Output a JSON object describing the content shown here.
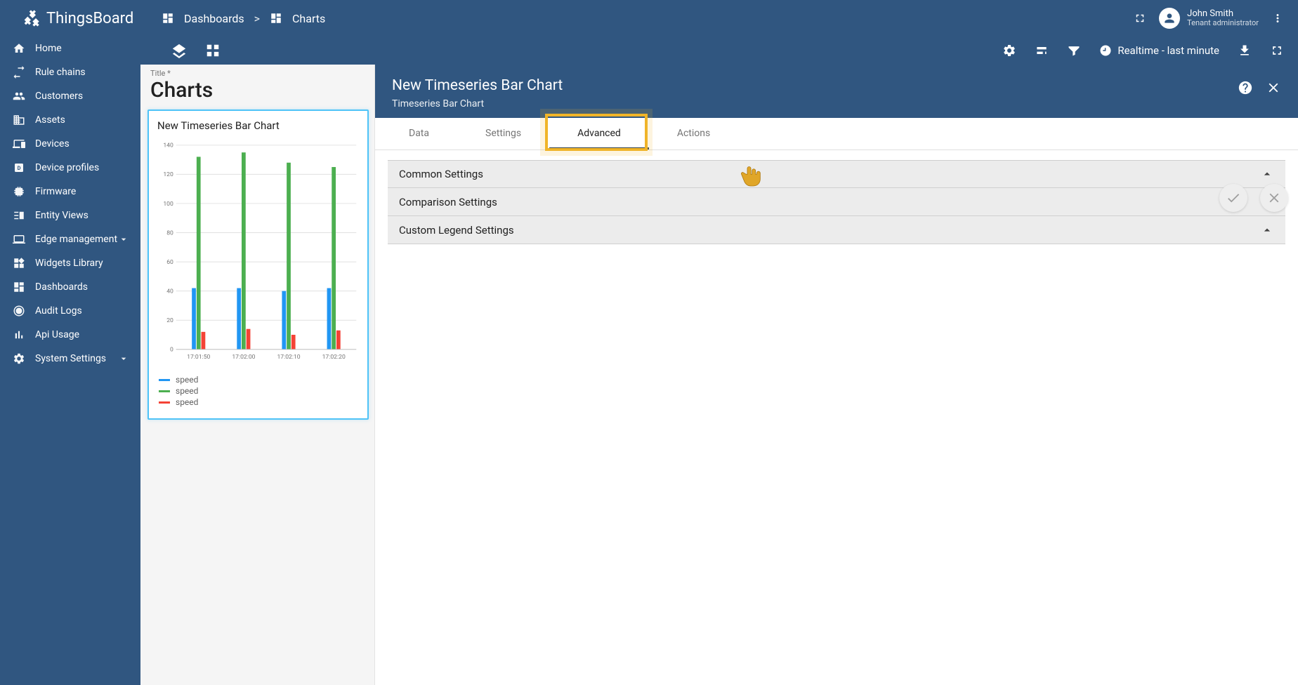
{
  "brand": "ThingsBoard",
  "breadcrumbs": {
    "root": "Dashboards",
    "sep": ">",
    "current": "Charts"
  },
  "user": {
    "name": "John Smith",
    "role": "Tenant administrator"
  },
  "sidebar": {
    "items": [
      {
        "label": "Home"
      },
      {
        "label": "Rule chains"
      },
      {
        "label": "Customers"
      },
      {
        "label": "Assets"
      },
      {
        "label": "Devices"
      },
      {
        "label": "Device profiles"
      },
      {
        "label": "Firmware"
      },
      {
        "label": "Entity Views"
      },
      {
        "label": "Edge management",
        "expandable": true
      },
      {
        "label": "Widgets Library"
      },
      {
        "label": "Dashboards"
      },
      {
        "label": "Audit Logs"
      },
      {
        "label": "Api Usage"
      },
      {
        "label": "System Settings",
        "expandable": true
      }
    ]
  },
  "toolbar": {
    "timewindow": "Realtime - last minute"
  },
  "edit_pane": {
    "title_label": "Title *",
    "title_value": "Charts",
    "widget_title": "New Timeseries Bar Chart",
    "legend": [
      {
        "color": "#2196f3",
        "label": "speed"
      },
      {
        "color": "#4caf50",
        "label": "speed"
      },
      {
        "color": "#f44336",
        "label": "speed"
      }
    ]
  },
  "chart_data": {
    "type": "bar",
    "title": "New Timeseries Bar Chart",
    "xlabel": "",
    "ylabel": "",
    "ylim": [
      0,
      140
    ],
    "yticks": [
      0,
      20,
      40,
      60,
      80,
      100,
      120,
      140
    ],
    "categories": [
      "17:01:50",
      "17:02:00",
      "17:02:10",
      "17:02:20"
    ],
    "series": [
      {
        "name": "speed",
        "color": "#2196f3",
        "values": [
          42,
          42,
          40,
          42
        ]
      },
      {
        "name": "speed",
        "color": "#4caf50",
        "values": [
          132,
          135,
          128,
          125
        ]
      },
      {
        "name": "speed",
        "color": "#f44336",
        "values": [
          12,
          14,
          10,
          13
        ]
      }
    ]
  },
  "detail": {
    "title": "New Timeseries Bar Chart",
    "subtitle": "Timeseries Bar Chart",
    "tabs": [
      "Data",
      "Settings",
      "Advanced",
      "Actions"
    ],
    "active_tab": 2,
    "sections": [
      "Common Settings",
      "Comparison Settings",
      "Custom Legend Settings"
    ]
  }
}
